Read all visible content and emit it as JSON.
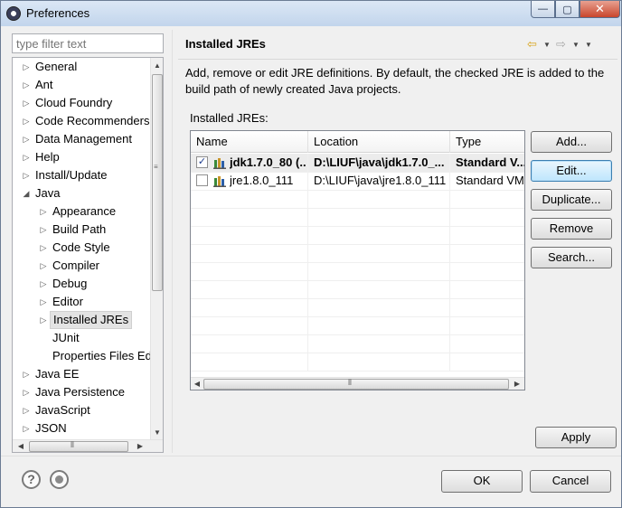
{
  "window": {
    "title": "Preferences",
    "minimize_glyph": "—",
    "maximize_glyph": "▢",
    "close_glyph": "✕"
  },
  "filter": {
    "placeholder": "type filter text"
  },
  "tree": {
    "items": [
      {
        "label": "General",
        "expandable": true,
        "depth": 0
      },
      {
        "label": "Ant",
        "expandable": true,
        "depth": 0
      },
      {
        "label": "Cloud Foundry",
        "expandable": true,
        "depth": 0
      },
      {
        "label": "Code Recommenders",
        "expandable": true,
        "depth": 0
      },
      {
        "label": "Data Management",
        "expandable": true,
        "depth": 0
      },
      {
        "label": "Help",
        "expandable": true,
        "depth": 0
      },
      {
        "label": "Install/Update",
        "expandable": true,
        "depth": 0
      },
      {
        "label": "Java",
        "expandable": true,
        "expanded": true,
        "depth": 0
      },
      {
        "label": "Appearance",
        "expandable": true,
        "depth": 1
      },
      {
        "label": "Build Path",
        "expandable": true,
        "depth": 1
      },
      {
        "label": "Code Style",
        "expandable": true,
        "depth": 1
      },
      {
        "label": "Compiler",
        "expandable": true,
        "depth": 1
      },
      {
        "label": "Debug",
        "expandable": true,
        "depth": 1
      },
      {
        "label": "Editor",
        "expandable": true,
        "depth": 1
      },
      {
        "label": "Installed JREs",
        "expandable": true,
        "depth": 1,
        "selected": true
      },
      {
        "label": "JUnit",
        "expandable": false,
        "depth": 1
      },
      {
        "label": "Properties Files Ed",
        "expandable": false,
        "depth": 1
      },
      {
        "label": "Java EE",
        "expandable": true,
        "depth": 0
      },
      {
        "label": "Java Persistence",
        "expandable": true,
        "depth": 0
      },
      {
        "label": "JavaScript",
        "expandable": true,
        "depth": 0
      },
      {
        "label": "JSON",
        "expandable": true,
        "depth": 0
      }
    ]
  },
  "page": {
    "title": "Installed JREs",
    "description": "Add, remove or edit JRE definitions. By default, the checked JRE is added to the build path of newly created Java projects.",
    "list_label": "Installed JREs:",
    "nav": {
      "back_icon": "⇦",
      "forward_icon": "⇨",
      "menu_icon": "▼"
    }
  },
  "jre_table": {
    "columns": [
      "Name",
      "Location",
      "Type"
    ],
    "rows": [
      {
        "checked": true,
        "name": "jdk1.7.0_80 (...",
        "location": "D:\\LIUF\\java\\jdk1.7.0_...",
        "type": "Standard V...",
        "bold": true
      },
      {
        "checked": false,
        "name": "jre1.8.0_111",
        "location": "D:\\LIUF\\java\\jre1.8.0_111",
        "type": "Standard VM",
        "bold": false
      }
    ]
  },
  "buttons": {
    "add": "Add...",
    "edit": "Edit...",
    "duplicate": "Duplicate...",
    "remove": "Remove",
    "search": "Search...",
    "apply": "Apply",
    "ok": "OK",
    "cancel": "Cancel"
  },
  "footer": {
    "help_glyph": "?"
  }
}
